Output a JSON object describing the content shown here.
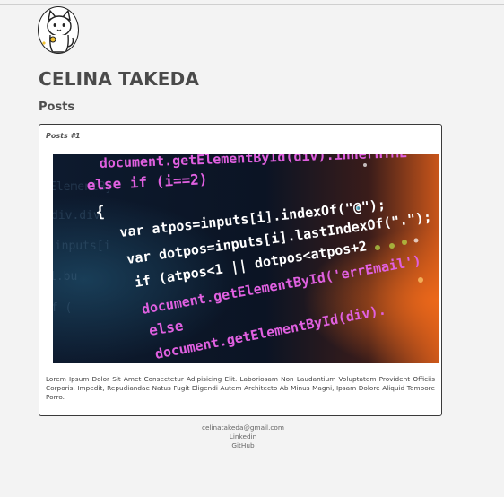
{
  "header": {
    "name": "CELINA TAKEDA",
    "avatar_icon": "cat-avatar-icon"
  },
  "posts_section": {
    "heading": "Posts",
    "posts": [
      {
        "label": "Posts #1",
        "image_icon": "code-screenshot-image",
        "body_part1": "Lorem Ipsum Dolor Sit Amet ",
        "body_strike1": "Consectetur Adipisicing",
        "body_part2": " Elit. Laboriosam Non Laudantium Voluptatem Provident ",
        "body_strike2": "Officiis Corporis",
        "body_part3": ", Impedit, Repudiandae Natus Fugit Eligendi Autem Architecto Ab Minus Magni, Ipsam Dolore Aliquid Tempore Porro."
      }
    ]
  },
  "code_lines": [
    "document.getElementById(div).innerHTML",
    "else if (i==2)",
    "{",
    "var atpos=inputs[i].indexOf(\"@\");",
    "var dotpos=inputs[i].lastIndexOf(\".\");",
    "if (atpos<1 || dotpos<atpos+2",
    "document.getElementById('errEmail')",
    "else",
    "document.getElementById(div)."
  ],
  "footer": {
    "email": "celinatakeda@gmail.com",
    "linkedin": "Linkedin",
    "github": "GitHub"
  },
  "colors": {
    "page_bg": "#f3f3f3",
    "card_border": "#3a3a3a",
    "title_text": "#4a4a4a",
    "code_keyword": "#e060e0",
    "code_text": "#ffffff",
    "code_method": "#4fc3e0",
    "code_string": "#b8e04a"
  }
}
